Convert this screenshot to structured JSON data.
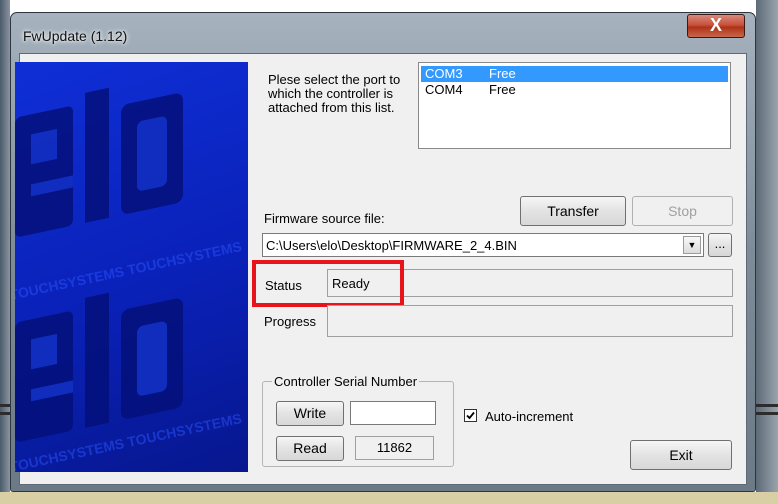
{
  "window": {
    "title": "FwUpdate (1.12)",
    "close_glyph": "X"
  },
  "port_prompt": "Plese select the port to which the controller is attached from this list.",
  "ports": [
    {
      "name": "COM3",
      "status": "Free",
      "selected": true
    },
    {
      "name": "COM4",
      "status": "Free",
      "selected": false
    }
  ],
  "firmware": {
    "label": "Firmware source file:",
    "path": "C:\\Users\\elo\\Desktop\\FIRMWARE_2_4.BIN",
    "dropdown_icon": "chevron-down-icon",
    "browse_label": "..."
  },
  "buttons": {
    "transfer": "Transfer",
    "stop": "Stop",
    "write": "Write",
    "read": "Read",
    "exit": "Exit"
  },
  "status": {
    "label": "Status",
    "value": "Ready"
  },
  "progress": {
    "label": "Progress",
    "value": 0
  },
  "serial": {
    "group_label": "Controller Serial Number",
    "write_value": "",
    "read_value": "11862"
  },
  "auto_increment": {
    "label": "Auto-increment",
    "checked": true
  },
  "logo": {
    "brand": "elo",
    "tagline": "TOUCHSYSTEMS"
  },
  "colors": {
    "logo_blue": "#0a21b8",
    "selection": "#3399ff",
    "highlight": "#e8141c",
    "close_red": "#c8523c"
  }
}
